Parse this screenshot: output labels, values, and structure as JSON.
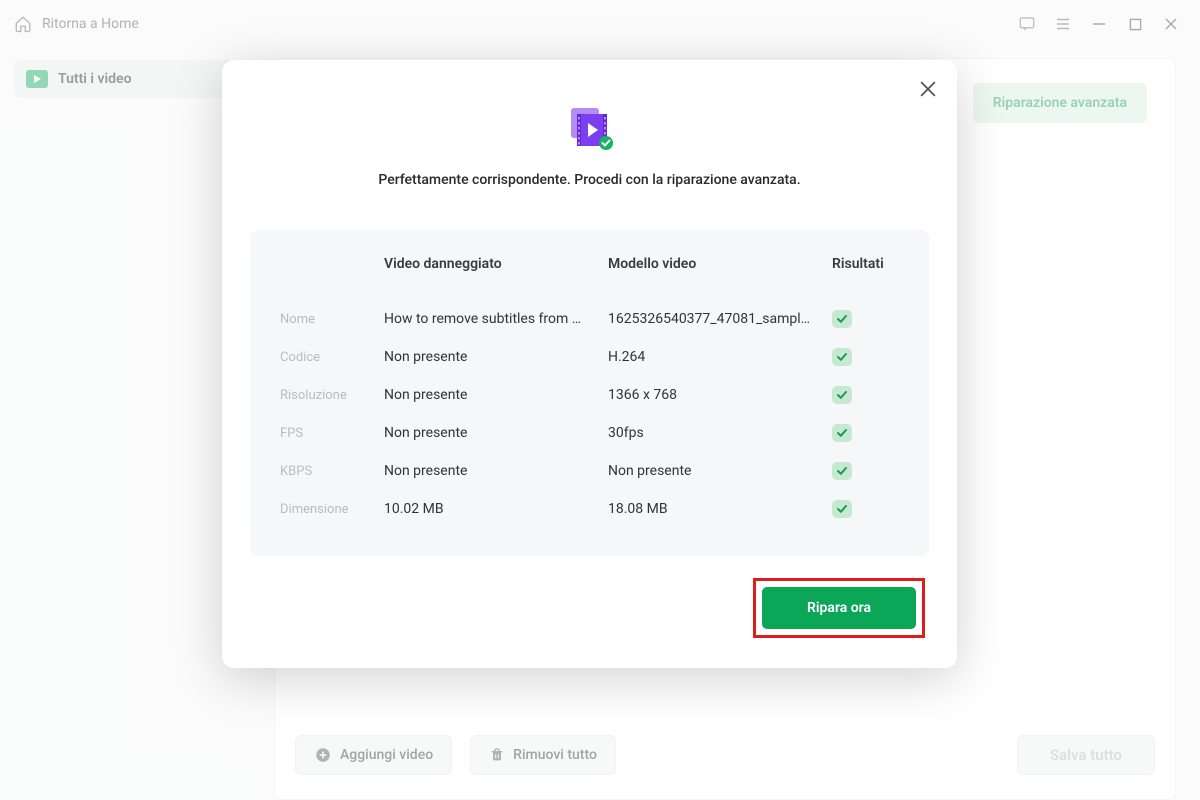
{
  "titlebar": {
    "back_label": "Ritorna a Home"
  },
  "sidebar": {
    "all_videos": "Tutti i video"
  },
  "content": {
    "advanced_repair": "Riparazione avanzata"
  },
  "footer": {
    "add_video": "Aggiungi video",
    "remove_all": "Rimuovi tutto",
    "save_all": "Salva tutto"
  },
  "modal": {
    "message": "Perfettamente corrispondente. Procedi con la riparazione avanzata.",
    "heads": {
      "damaged": "Video danneggiato",
      "sample": "Modello video",
      "results": "Risultati"
    },
    "rows": [
      {
        "label": "Nome",
        "damaged": "How to remove subtitles from a ...",
        "sample": "1625326540377_47081_sample...."
      },
      {
        "label": "Codice",
        "damaged": "Non presente",
        "sample": "H.264"
      },
      {
        "label": "Risoluzione",
        "damaged": "Non presente",
        "sample": "1366 x 768"
      },
      {
        "label": "FPS",
        "damaged": "Non presente",
        "sample": "30fps"
      },
      {
        "label": "KBPS",
        "damaged": "Non presente",
        "sample": "Non presente"
      },
      {
        "label": "Dimensione",
        "damaged": "10.02 MB",
        "sample": "18.08 MB"
      }
    ],
    "repair_now": "Ripara ora"
  }
}
